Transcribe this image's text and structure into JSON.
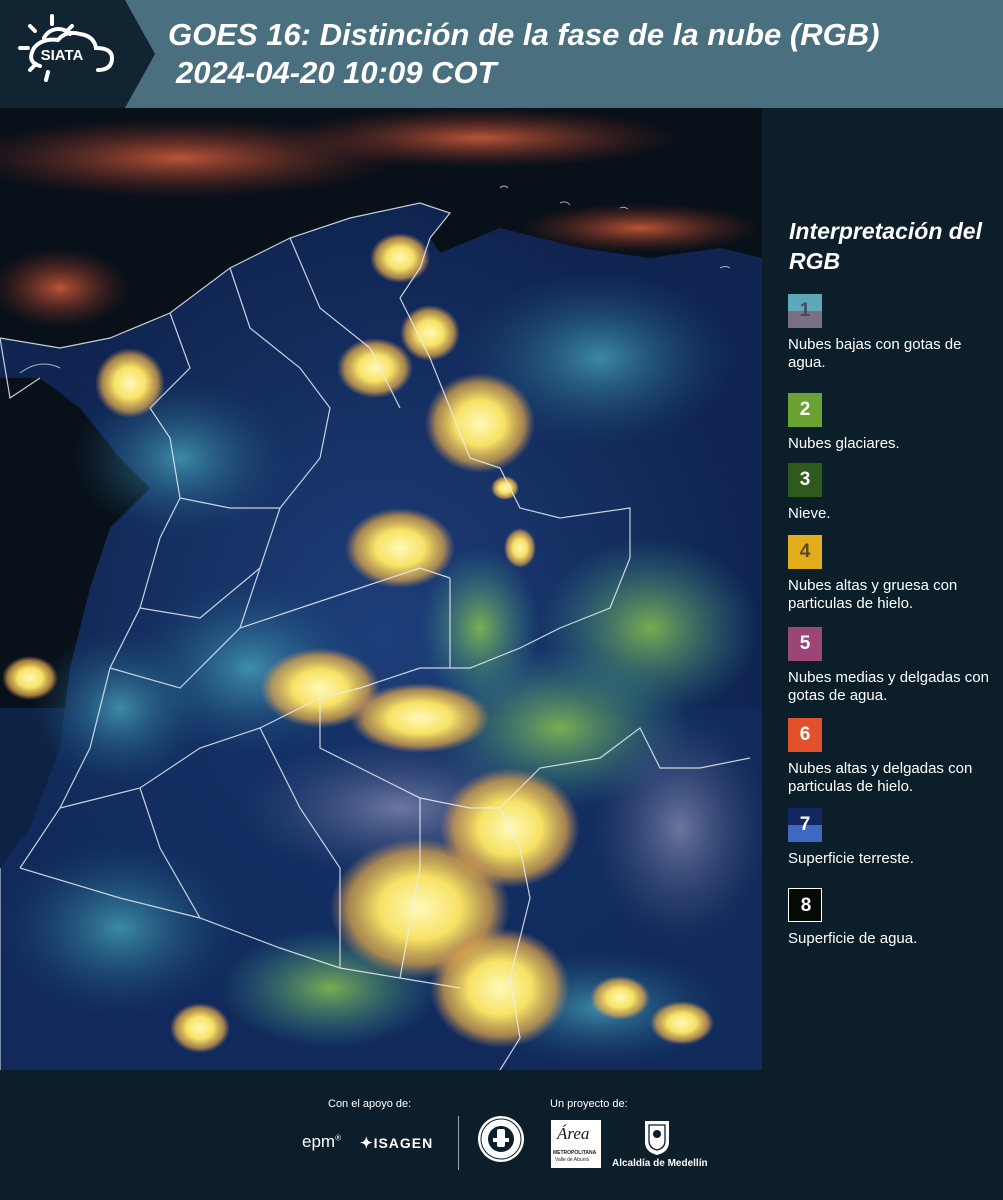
{
  "header": {
    "logo_text": "SIATA",
    "title_line1": "GOES 16: Distinción de la fase de la nube (RGB)",
    "title_line2": "2024-04-20 10:09 COT",
    "background_color": "#4a6f7e"
  },
  "legend": {
    "title": "Interpretación del RGB",
    "items": [
      {
        "number": "1",
        "label": "Nubes bajas con gotas de agua.",
        "color_top": "#5ea9b8",
        "color_bottom": "#7b6f86",
        "number_color": "#4a4a5a"
      },
      {
        "number": "2",
        "label": "Nubes glaciares.",
        "color_top": "#6aa232",
        "color_bottom": "#6aa232",
        "number_color": "#ffffff"
      },
      {
        "number": "3",
        "label": "Nieve.",
        "color_top": "#2f5a1e",
        "color_bottom": "#2f5a1e",
        "number_color": "#ffffff"
      },
      {
        "number": "4",
        "label": "Nubes altas y gruesa con particulas de hielo.",
        "color_top": "#e2ac1a",
        "color_bottom": "#e2ac1a",
        "number_color": "#5a4a20"
      },
      {
        "number": "5",
        "label": "Nubes medias y delgadas con gotas de agua.",
        "color_top": "#9c4577",
        "color_bottom": "#9c4577",
        "number_color": "#ffffff"
      },
      {
        "number": "6",
        "label": "Nubes altas y delgadas con particulas de hielo.",
        "color_top": "#e3512c",
        "color_bottom": "#e3512c",
        "number_color": "#ffffff"
      },
      {
        "number": "7",
        "label": "Superficie terreste.",
        "color_top": "#12265f",
        "color_bottom": "#3e68c2",
        "number_color": "#ffffff"
      },
      {
        "number": "8",
        "label": "Superficie de agua.",
        "color_top": "#050a05",
        "color_bottom": "#050a05",
        "number_color": "#ffffff"
      }
    ]
  },
  "footer": {
    "support_label": "Con el apoyo de:",
    "project_label": "Un proyecto de:",
    "sponsor_epm": "epm",
    "sponsor_isagen": "ISAGEN",
    "area_text": "Área",
    "area_sub1": "METROPOLITANA",
    "area_sub2": "Valle de Aburrá",
    "alcaldia": "Alcaldía de Medellín"
  },
  "icons": [
    "siata-sun-cloud-logo",
    "epm-logo",
    "isagen-logo",
    "universidad-seal-logo",
    "area-metropolitana-logo",
    "alcaldia-medellin-shield"
  ]
}
